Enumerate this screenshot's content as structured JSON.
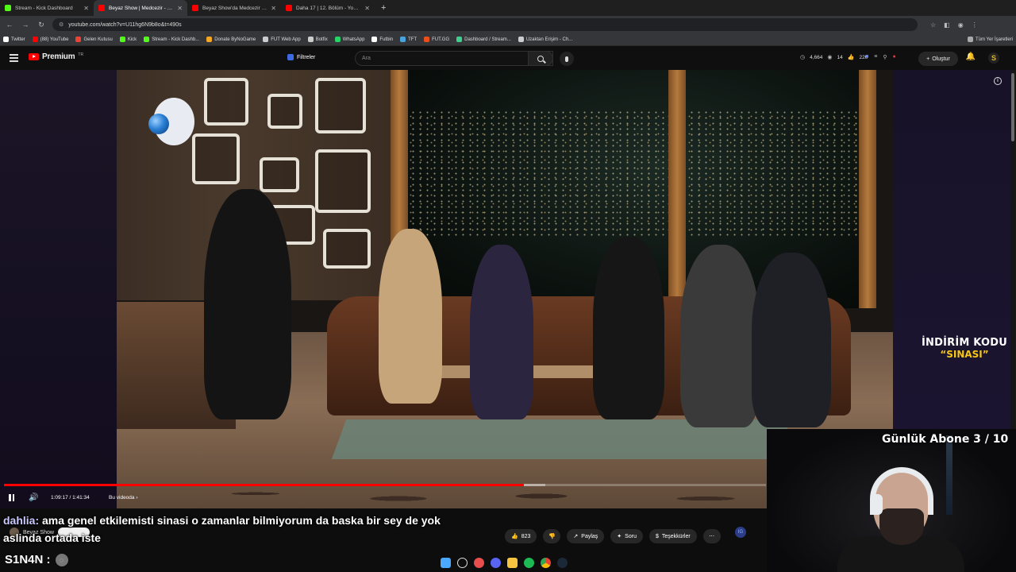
{
  "browser": {
    "tabs": [
      {
        "title": "Stream - Kick Dashboard",
        "favicon_color": "#53fc18",
        "active": false
      },
      {
        "title": "Beyaz Show | Medcezir - Se",
        "favicon_color": "#ff0000",
        "active": true
      },
      {
        "title": "Beyaz Show'da Medcezir skeç",
        "favicon_color": "#ff0000",
        "active": false
      },
      {
        "title": "Daha 17 | 12. Bölüm - YouTube",
        "favicon_color": "#ff0000",
        "active": false
      }
    ],
    "url": "youtube.com/watch?v=U11hg6N9b8o&t=490s",
    "bookmarks": [
      {
        "label": "Twitter",
        "color": "#ffffff"
      },
      {
        "label": "(88) YouTube",
        "color": "#ff0000"
      },
      {
        "label": "Gelen Kutusu",
        "color": "#ea4335"
      },
      {
        "label": "Kick",
        "color": "#53fc18"
      },
      {
        "label": "Stream - Kick Dashb...",
        "color": "#53fc18"
      },
      {
        "label": "Donate ByNoGame",
        "color": "#f5a623"
      },
      {
        "label": "FUT Web App",
        "color": "#cccccc"
      },
      {
        "label": "Botfix",
        "color": "#cccccc"
      },
      {
        "label": "WhatsApp",
        "color": "#25d366"
      },
      {
        "label": "Futbin",
        "color": "#ffffff"
      },
      {
        "label": "TFT",
        "color": "#4aa3df"
      },
      {
        "label": "FUT.GG",
        "color": "#e94e1b"
      },
      {
        "label": "Dashboard / Stream...",
        "color": "#3ecf8e"
      },
      {
        "label": "Uzaktan Erişim - Ch...",
        "color": "#cccccc"
      }
    ],
    "all_bookmarks": "Tüm Yer İşaretleri"
  },
  "youtube": {
    "logo": "Premium",
    "logo_sup": "TR",
    "filter_label": "Filtreler",
    "search_placeholder": "Ara",
    "stats": {
      "viewers": "4,664",
      "watching": "14",
      "likes": "220"
    },
    "create_label": "Oluştur",
    "avatar_letter": "S"
  },
  "player": {
    "time": "1:09:17 / 1:41:34",
    "chapter": "Bu videoda",
    "progress_fraction": 0.682,
    "buffer_fraction": 0.71
  },
  "overlay": {
    "promo_line1": "İNDİRİM KODU",
    "promo_line2": "“SINASI”",
    "goal_text": "Günlük Abone 3 / 10"
  },
  "chat": {
    "user": "dahlia:",
    "message": "ama genel etkilemisti sinasi o zamanlar bilmiyorum da baska bir sey de yok aslinda ortada iste"
  },
  "channel": {
    "name": "Beyaz Show"
  },
  "actions": {
    "likes": "823",
    "share": "Paylaş",
    "ask": "Soru",
    "thanks": "Teşekkürler"
  },
  "streamer": {
    "name": "S1N4N :"
  }
}
